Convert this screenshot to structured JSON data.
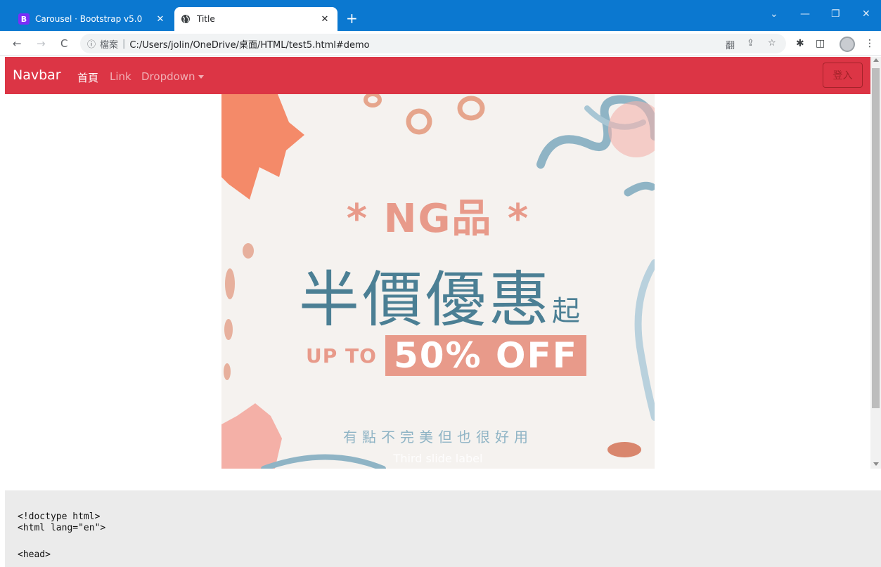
{
  "browser": {
    "tabs": [
      {
        "favicon": "B",
        "title": "Carousel · Bootstrap v5.0",
        "active": false
      },
      {
        "favicon": "globe-icon",
        "title": "Title",
        "active": true
      }
    ],
    "new_tab": "+",
    "close_glyph": "✕",
    "window_controls": {
      "dropdown": "⌄",
      "minimize": "—",
      "restore": "❐",
      "close": "✕"
    },
    "nav": {
      "back": "←",
      "forward": "→",
      "reload": "C"
    },
    "address": {
      "info_icon": "ⓘ",
      "label": "檔案",
      "separator": "|",
      "url": "C:/Users/jolin/OneDrive/桌面/HTML/test5.html#demo"
    },
    "toolbar_icons": {
      "translate": "翻",
      "share": "⇪",
      "bookmark": "☆",
      "extensions": "✱",
      "sidepanel": "◫",
      "menu": "⋮"
    }
  },
  "navbar": {
    "brand": "Navbar",
    "items": [
      "首頁",
      "Link",
      "Dropdown"
    ],
    "login": "登入",
    "color": "#dc3545"
  },
  "carousel": {
    "headline": "* NG品 *",
    "main_text": "半價優惠",
    "main_suffix": "起",
    "up_to": "UP TO",
    "offer": "50% OFF",
    "sub_text": "有點不完美但也很好用",
    "caption": "Third slide label",
    "colors": {
      "coral": "#e89a8a",
      "teal": "#4b7f94",
      "blue": "#8fb4c5",
      "orange": "#f47e5a"
    }
  },
  "code": {
    "lines": [
      "<!doctype html>",
      "<html lang=\"en\">",
      "",
      "<head>"
    ]
  }
}
